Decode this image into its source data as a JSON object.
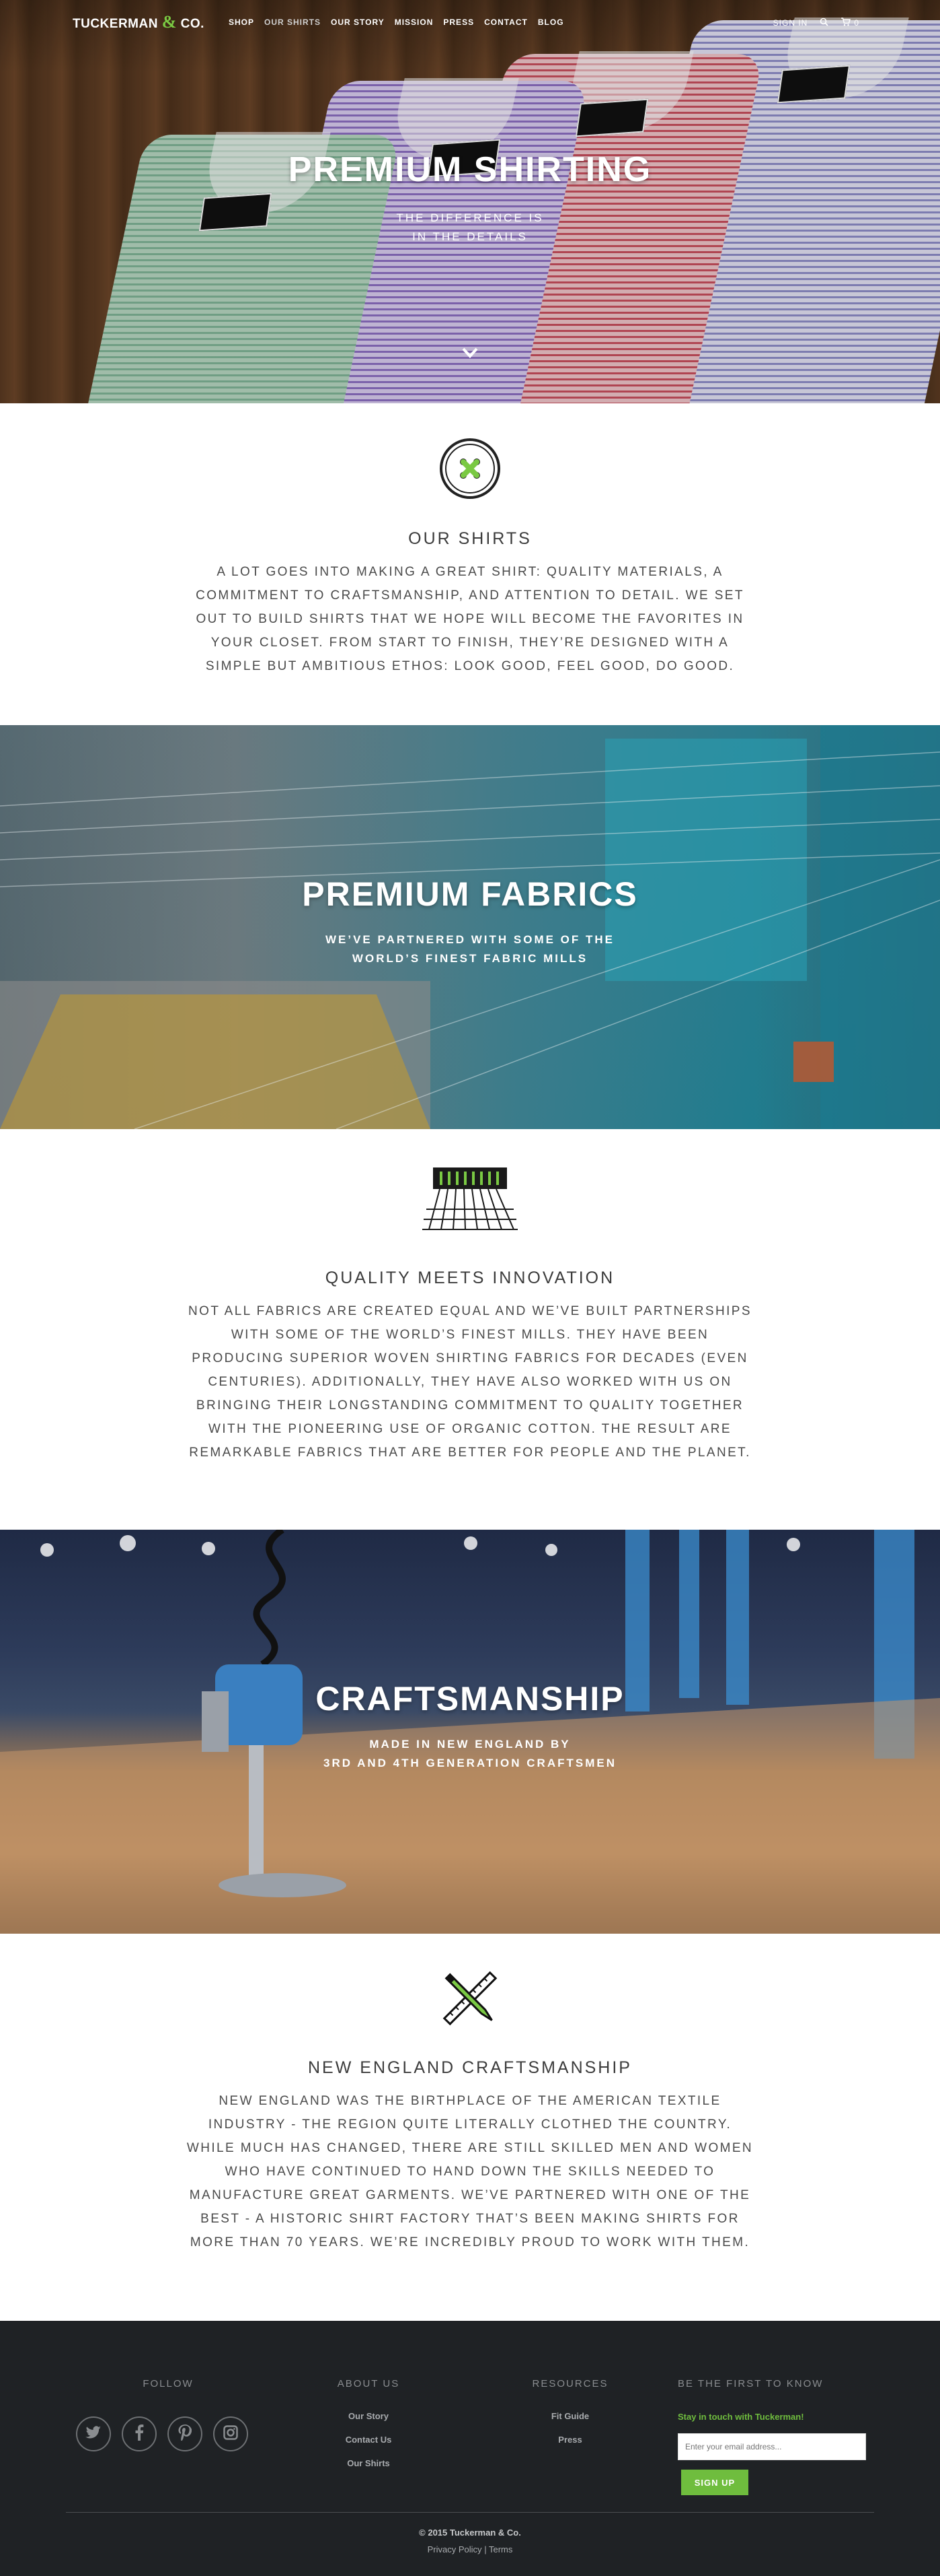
{
  "nav": {
    "logo_left": "TUCKERMAN",
    "logo_amp": "&",
    "logo_right": "CO.",
    "links": [
      "SHOP",
      "OUR SHIRTS",
      "OUR STORY",
      "MISSION",
      "PRESS",
      "CONTACT",
      "BLOG"
    ],
    "sign_in": "SIGN IN",
    "cart_count": "0"
  },
  "hero": {
    "title": "PREMIUM SHIRTING",
    "subtitle_line1": "THE DIFFERENCE IS",
    "subtitle_line2": "IN THE DETAILS"
  },
  "shirts": {
    "heading": "OUR SHIRTS",
    "body": "A LOT GOES INTO MAKING A GREAT SHIRT: QUALITY MATERIALS, A COMMITMENT TO CRAFTSMANSHIP, AND ATTENTION TO DETAIL. WE SET OUT TO BUILD SHIRTS THAT WE HOPE WILL BECOME THE FAVORITES IN YOUR CLOSET. FROM START TO FINISH, THEY’RE DESIGNED WITH A SIMPLE BUT AMBITIOUS ETHOS: LOOK GOOD, FEEL GOOD, DO GOOD."
  },
  "fabrics_banner": {
    "title": "PREMIUM FABRICS",
    "subtitle_line1": "WE’VE PARTNERED WITH SOME OF THE",
    "subtitle_line2": "WORLD’S FINEST FABRIC MILLS"
  },
  "innovation": {
    "heading": "QUALITY MEETS INNOVATION",
    "body": "NOT ALL FABRICS ARE CREATED EQUAL AND WE’VE BUILT PARTNERSHIPS WITH SOME OF THE WORLD’S FINEST MILLS. THEY HAVE BEEN PRODUCING SUPERIOR WOVEN SHIRTING FABRICS FOR DECADES (EVEN CENTURIES). ADDITIONALLY, THEY HAVE ALSO WORKED WITH US ON BRINGING THEIR LONGSTANDING COMMITMENT TO QUALITY TOGETHER WITH THE PIONEERING USE OF ORGANIC COTTON. THE RESULT ARE REMARKABLE FABRICS THAT ARE BETTER FOR PEOPLE AND THE PLANET."
  },
  "craft_banner": {
    "title": "CRAFTSMANSHIP",
    "subtitle_line1": "MADE IN NEW ENGLAND BY",
    "subtitle_line2": "3RD AND 4TH GENERATION CRAFTSMEN"
  },
  "new_england": {
    "heading": "NEW ENGLAND CRAFTSMANSHIP",
    "body": "NEW ENGLAND WAS THE BIRTHPLACE OF THE AMERICAN TEXTILE INDUSTRY - THE REGION QUITE LITERALLY CLOTHED THE COUNTRY. WHILE MUCH HAS CHANGED, THERE ARE STILL SKILLED MEN AND WOMEN WHO HAVE CONTINUED TO HAND DOWN THE SKILLS NEEDED TO MANUFACTURE GREAT GARMENTS. WE’VE PARTNERED WITH ONE OF THE BEST - A HISTORIC SHIRT FACTORY THAT’S BEEN MAKING SHIRTS FOR MORE THAN 70 YEARS. WE’RE INCREDIBLY PROUD TO WORK WITH THEM."
  },
  "footer": {
    "follow_title": "FOLLOW",
    "about_title": "ABOUT US",
    "about_links": [
      "Our Story",
      "Contact Us",
      "Our Shirts"
    ],
    "resources_title": "RESOURCES",
    "resources_links": [
      "Fit Guide",
      "Press"
    ],
    "newsletter_title": "BE THE FIRST TO KNOW",
    "newsletter_text": "Stay in touch with Tuckerman!",
    "email_placeholder": "Enter your email address...",
    "signup_label": "SIGN UP",
    "copyright": "© 2015 Tuckerman & Co.",
    "privacy": "Privacy Policy",
    "separator": "|",
    "terms": "Terms"
  },
  "colors": {
    "accent_green": "#7ac943",
    "footer_bg": "#1f2225",
    "signup_green": "#6fbd3e"
  },
  "icons": [
    "button-icon",
    "fabric-swatch-icon",
    "needle-ruler-icon",
    "twitter-icon",
    "facebook-icon",
    "pinterest-icon",
    "instagram-icon",
    "search-icon",
    "cart-icon",
    "chevron-down-icon"
  ]
}
